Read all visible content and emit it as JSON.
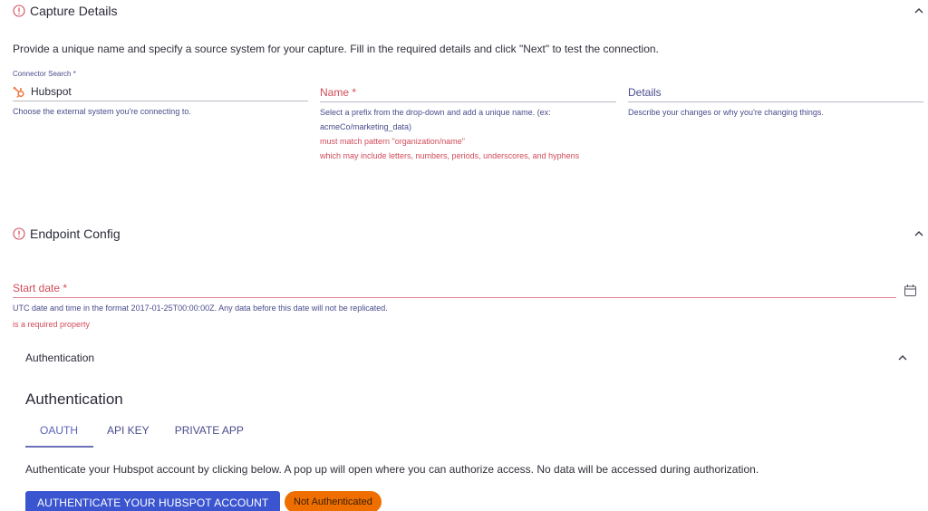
{
  "capture_details": {
    "title": "Capture Details",
    "status_icon": "error-circle-icon",
    "collapse_icon": "chevron-up-icon",
    "intro": "Provide a unique name and specify a source system for your capture. Fill in the required details and click \"Next\" to test the connection.",
    "connector": {
      "label": "Connector Search *",
      "value": "Hubspot",
      "icon": "hubspot-logo-icon",
      "helper": "Choose the external system you're connecting to."
    },
    "name": {
      "label": "Name *",
      "helper": "Select a prefix from the drop-down and add a unique name. (ex: acmeCo/marketing_data)",
      "error_line1": "must match pattern \"organization/name\"",
      "error_line2": "which may include letters, numbers, periods, underscores, and hyphens"
    },
    "details": {
      "label": "Details",
      "helper": "Describe your changes or why you're changing things."
    }
  },
  "endpoint_config": {
    "title": "Endpoint Config",
    "status_icon": "error-circle-icon",
    "collapse_icon": "chevron-up-icon",
    "start_date": {
      "label": "Start date *",
      "helper": "UTC date and time in the format 2017-01-25T00:00:00Z. Any data before this date will not be replicated.",
      "error": "is a required property",
      "icon": "calendar-icon"
    },
    "authentication": {
      "section_label": "Authentication",
      "title": "Authentication",
      "tabs": [
        {
          "label": "OAuth",
          "active": true
        },
        {
          "label": "API Key",
          "active": false
        },
        {
          "label": "Private App",
          "active": false
        }
      ],
      "description": "Authenticate your Hubspot account by clicking below. A pop up will open where you can authorize access. No data will be accessed during authorization.",
      "button_label": "AUTHENTICATE YOUR HUBSPOT ACCOUNT",
      "status_chip": "Not Authenticated"
    }
  },
  "colors": {
    "error": "#d24b5a",
    "primary": "#3b55d0",
    "warning_chip": "#ee6f00",
    "muted_text": "#4a4c8c",
    "tab_active": "#5a62b8"
  }
}
